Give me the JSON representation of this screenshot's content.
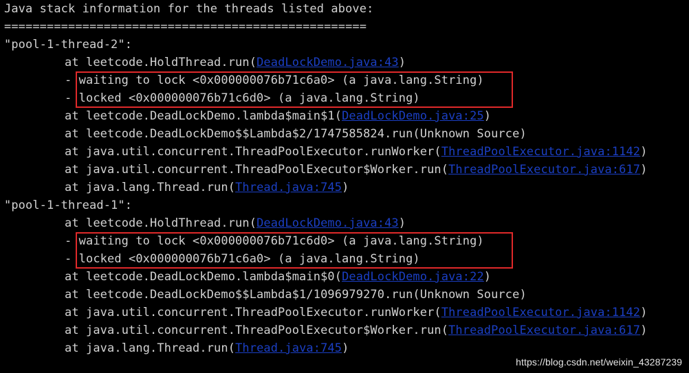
{
  "header": {
    "title": "Java stack information for the threads listed above:",
    "separator": "==================================================="
  },
  "threads": [
    {
      "name": "\"pool-1-thread-2\":",
      "frames": [
        {
          "prefix": "at ",
          "text": "leetcode.HoldThread.run(",
          "link": "DeadLockDemo.java:43",
          "suffix": ")"
        },
        {
          "prefix": "- ",
          "text": "waiting to lock <0x000000076b71c6a0> (a java.lang.String)"
        },
        {
          "prefix": "- ",
          "text": "locked <0x000000076b71c6d0> (a java.lang.String)"
        },
        {
          "prefix": "at ",
          "text": "leetcode.DeadLockDemo.lambda$main$1(",
          "link": "DeadLockDemo.java:25",
          "suffix": ")"
        },
        {
          "prefix": "at ",
          "text": "leetcode.DeadLockDemo$$Lambda$2/1747585824.run(Unknown Source)"
        },
        {
          "prefix": "at ",
          "text": "java.util.concurrent.ThreadPoolExecutor.runWorker(",
          "link": "ThreadPoolExecutor.java:1142",
          "suffix": ")"
        },
        {
          "prefix": "at ",
          "text": "java.util.concurrent.ThreadPoolExecutor$Worker.run(",
          "link": "ThreadPoolExecutor.java:617",
          "suffix": ")"
        },
        {
          "prefix": "at ",
          "text": "java.lang.Thread.run(",
          "link": "Thread.java:745",
          "suffix": ")"
        }
      ]
    },
    {
      "name": "\"pool-1-thread-1\":",
      "frames": [
        {
          "prefix": "at ",
          "text": "leetcode.HoldThread.run(",
          "link": "DeadLockDemo.java:43",
          "suffix": ")"
        },
        {
          "prefix": "- ",
          "text": "waiting to lock <0x000000076b71c6d0> (a java.lang.String)"
        },
        {
          "prefix": "- ",
          "text": "locked <0x000000076b71c6a0> (a java.lang.String)"
        },
        {
          "prefix": "at ",
          "text": "leetcode.DeadLockDemo.lambda$main$0(",
          "link": "DeadLockDemo.java:22",
          "suffix": ")"
        },
        {
          "prefix": "at ",
          "text": "leetcode.DeadLockDemo$$Lambda$1/1096979270.run(Unknown Source)"
        },
        {
          "prefix": "at ",
          "text": "java.util.concurrent.ThreadPoolExecutor.runWorker(",
          "link": "ThreadPoolExecutor.java:1142",
          "suffix": ")"
        },
        {
          "prefix": "at ",
          "text": "java.util.concurrent.ThreadPoolExecutor$Worker.run(",
          "link": "ThreadPoolExecutor.java:617",
          "suffix": ")"
        },
        {
          "prefix": "at ",
          "text": "java.lang.Thread.run(",
          "link": "Thread.java:745",
          "suffix": ")"
        }
      ]
    }
  ],
  "watermark": "https://blog.csdn.net/weixin_43287239",
  "colors": {
    "background": "#000000",
    "text": "#d2d2d2",
    "link": "#1b3fc4",
    "highlight": "#e0292a"
  }
}
